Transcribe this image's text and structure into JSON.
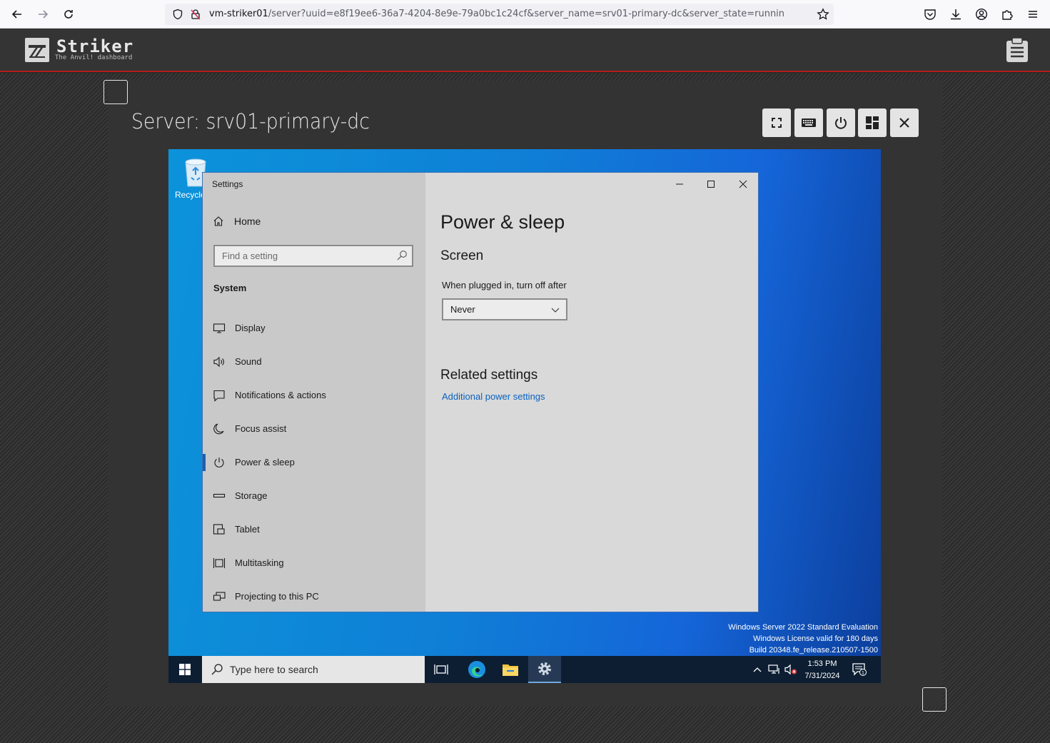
{
  "browser": {
    "url_host": "vm-striker01",
    "url_rest": "/server?uuid=e8f19ee6-36a7-4204-8e9e-79a0bc1c24cf&server_name=srv01-primary-dc&server_state=runnin"
  },
  "app": {
    "name": "Striker",
    "subtitle": "The Anvil! dashboard"
  },
  "server": {
    "title": "Server: srv01-primary-dc"
  },
  "desktop": {
    "recycle_label": "Recycle",
    "watermark": [
      "Windows Server 2022 Standard Evaluation",
      "Windows License valid for 180 days",
      "Build 20348.fe_release.210507-1500"
    ]
  },
  "settings": {
    "window_title": "Settings",
    "home": "Home",
    "search_placeholder": "Find a setting",
    "section": "System",
    "nav": [
      {
        "label": "Display",
        "icon": "monitor-icon"
      },
      {
        "label": "Sound",
        "icon": "speaker-icon"
      },
      {
        "label": "Notifications & actions",
        "icon": "notification-icon"
      },
      {
        "label": "Focus assist",
        "icon": "moon-icon"
      },
      {
        "label": "Power & sleep",
        "icon": "power-icon",
        "active": true
      },
      {
        "label": "Storage",
        "icon": "storage-icon"
      },
      {
        "label": "Tablet",
        "icon": "tablet-icon"
      },
      {
        "label": "Multitasking",
        "icon": "multitasking-icon"
      },
      {
        "label": "Projecting to this PC",
        "icon": "projecting-icon"
      }
    ],
    "pane": {
      "heading": "Power & sleep",
      "screen_heading": "Screen",
      "plugged_label": "When plugged in, turn off after",
      "plugged_value": "Never",
      "related_heading": "Related settings",
      "related_link": "Additional power settings"
    }
  },
  "taskbar": {
    "search_placeholder": "Type here to search",
    "time": "1:53 PM",
    "date": "7/31/2024",
    "notification_count": "1"
  },
  "colors": {
    "accent_red": "#b31b1b",
    "link_blue": "#0a62c2",
    "active_blue": "#1a5fb4"
  }
}
